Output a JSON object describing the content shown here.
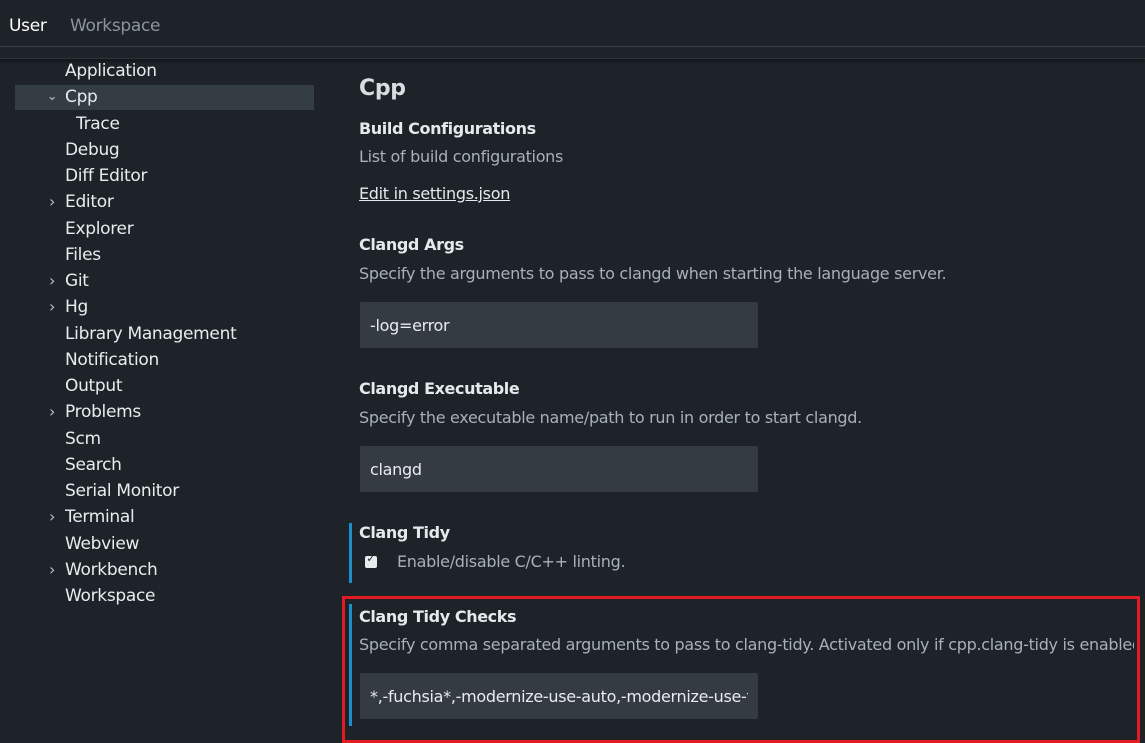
{
  "tabs": {
    "user": "User",
    "workspace": "Workspace"
  },
  "sidebar": {
    "items": [
      {
        "label": "Application",
        "chevron": ""
      },
      {
        "label": "Cpp",
        "chevron": "expanded"
      },
      {
        "label": "Trace",
        "chevron": ""
      },
      {
        "label": "Debug",
        "chevron": ""
      },
      {
        "label": "Diff Editor",
        "chevron": ""
      },
      {
        "label": "Editor",
        "chevron": "collapsed"
      },
      {
        "label": "Explorer",
        "chevron": ""
      },
      {
        "label": "Files",
        "chevron": ""
      },
      {
        "label": "Git",
        "chevron": "collapsed"
      },
      {
        "label": "Hg",
        "chevron": "collapsed"
      },
      {
        "label": "Library Management",
        "chevron": ""
      },
      {
        "label": "Notification",
        "chevron": ""
      },
      {
        "label": "Output",
        "chevron": ""
      },
      {
        "label": "Problems",
        "chevron": "collapsed"
      },
      {
        "label": "Scm",
        "chevron": ""
      },
      {
        "label": "Search",
        "chevron": ""
      },
      {
        "label": "Serial Monitor",
        "chevron": ""
      },
      {
        "label": "Terminal",
        "chevron": "collapsed"
      },
      {
        "label": "Webview",
        "chevron": ""
      },
      {
        "label": "Workbench",
        "chevron": "collapsed"
      },
      {
        "label": "Workspace",
        "chevron": ""
      }
    ]
  },
  "main": {
    "section_title": "Cpp",
    "build_configurations": {
      "title": "Build Configurations",
      "description": "List of build configurations",
      "link": "Edit in settings.json"
    },
    "clangd_args": {
      "title": "Clangd Args",
      "description": "Specify the arguments to pass to clangd when starting the language server.",
      "value": "-log=error"
    },
    "clangd_executable": {
      "title": "Clangd Executable",
      "description": "Specify the executable name/path to run in order to start clangd.",
      "value": "clangd"
    },
    "clang_tidy": {
      "title": "Clang Tidy",
      "checkbox_label": "Enable/disable C/C++ linting.",
      "checked": true
    },
    "clang_tidy_checks": {
      "title": "Clang Tidy Checks",
      "description": "Specify comma separated arguments to pass to clang-tidy. Activated only if cpp.clang-tidy is enabled",
      "value": "*,-fuchsia*,-modernize-use-auto,-modernize-use-trailing-return-type"
    }
  },
  "colors": {
    "background": "#1d2329",
    "selected_item": "#343c44",
    "modified_indicator": "#1c8fcc",
    "highlight_box": "#e31b23"
  }
}
